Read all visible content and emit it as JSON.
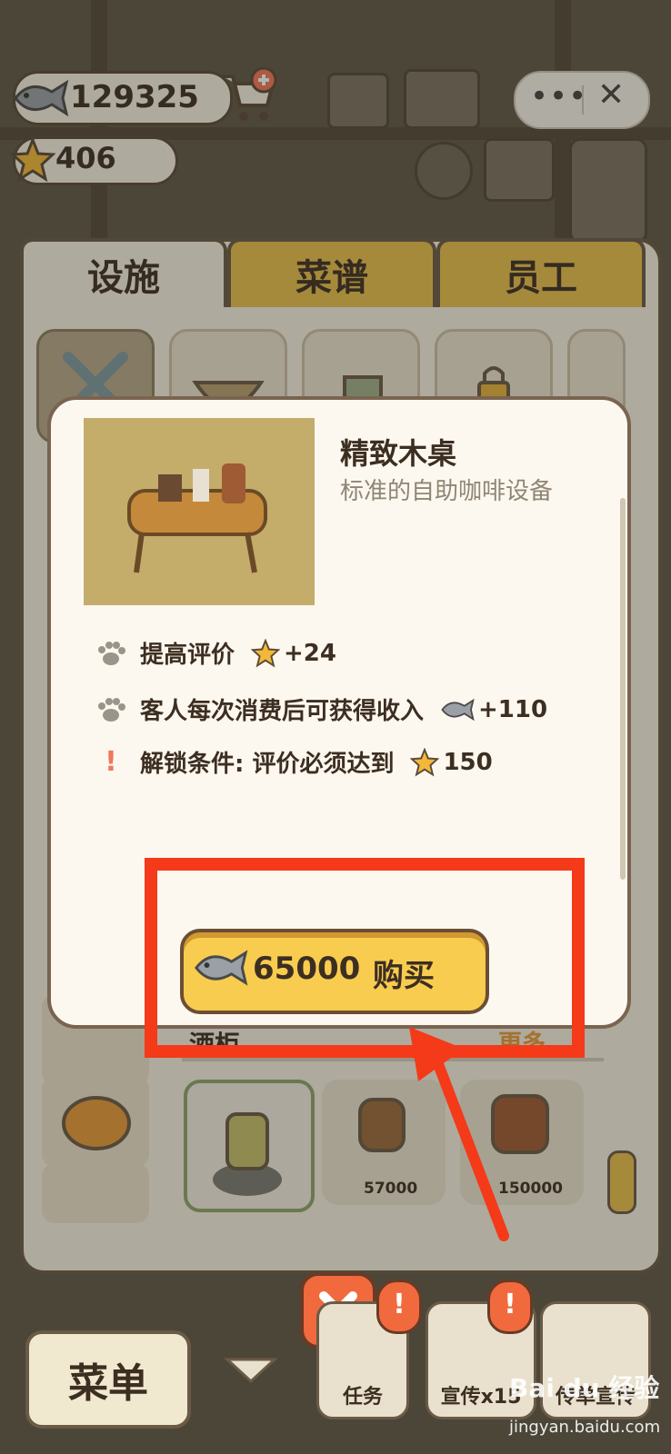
{
  "top_bar": {
    "fish_coins": "129325",
    "stars": "406"
  },
  "tabs": [
    "设施",
    "菜谱",
    "员工"
  ],
  "popup": {
    "title": "精致木桌",
    "subtitle": "标准的自助咖啡设备",
    "rows": [
      {
        "label": "提高评价",
        "value": "+24",
        "icon": "star-icon"
      },
      {
        "label": "客人每次消费后可获得收入",
        "value": "+110",
        "icon": "fish-icon"
      },
      {
        "label": "解锁条件: 评价必须达到",
        "value": "150",
        "icon": "star-icon"
      }
    ],
    "buy_price": "65000",
    "buy_label": "购买"
  },
  "behind_popup": {
    "section_label": "酒柜",
    "more_label": "更多",
    "items": [
      {
        "price": ""
      },
      {
        "price": "57000"
      },
      {
        "price": "150000"
      }
    ]
  },
  "bottom_bar": {
    "menu_label": "菜单",
    "task_label": "任务",
    "promo_label": "宣传x15",
    "flyer_label": "传单宣传"
  },
  "watermark": {
    "brand": "Bai du 经验",
    "url": "jingyan.baidu.com"
  },
  "colors": {
    "accent_yellow": "#f8cc4f",
    "highlight_red": "#f43a19",
    "panel_bg": "#f6f1e4",
    "border_brown": "#6a5a46"
  }
}
